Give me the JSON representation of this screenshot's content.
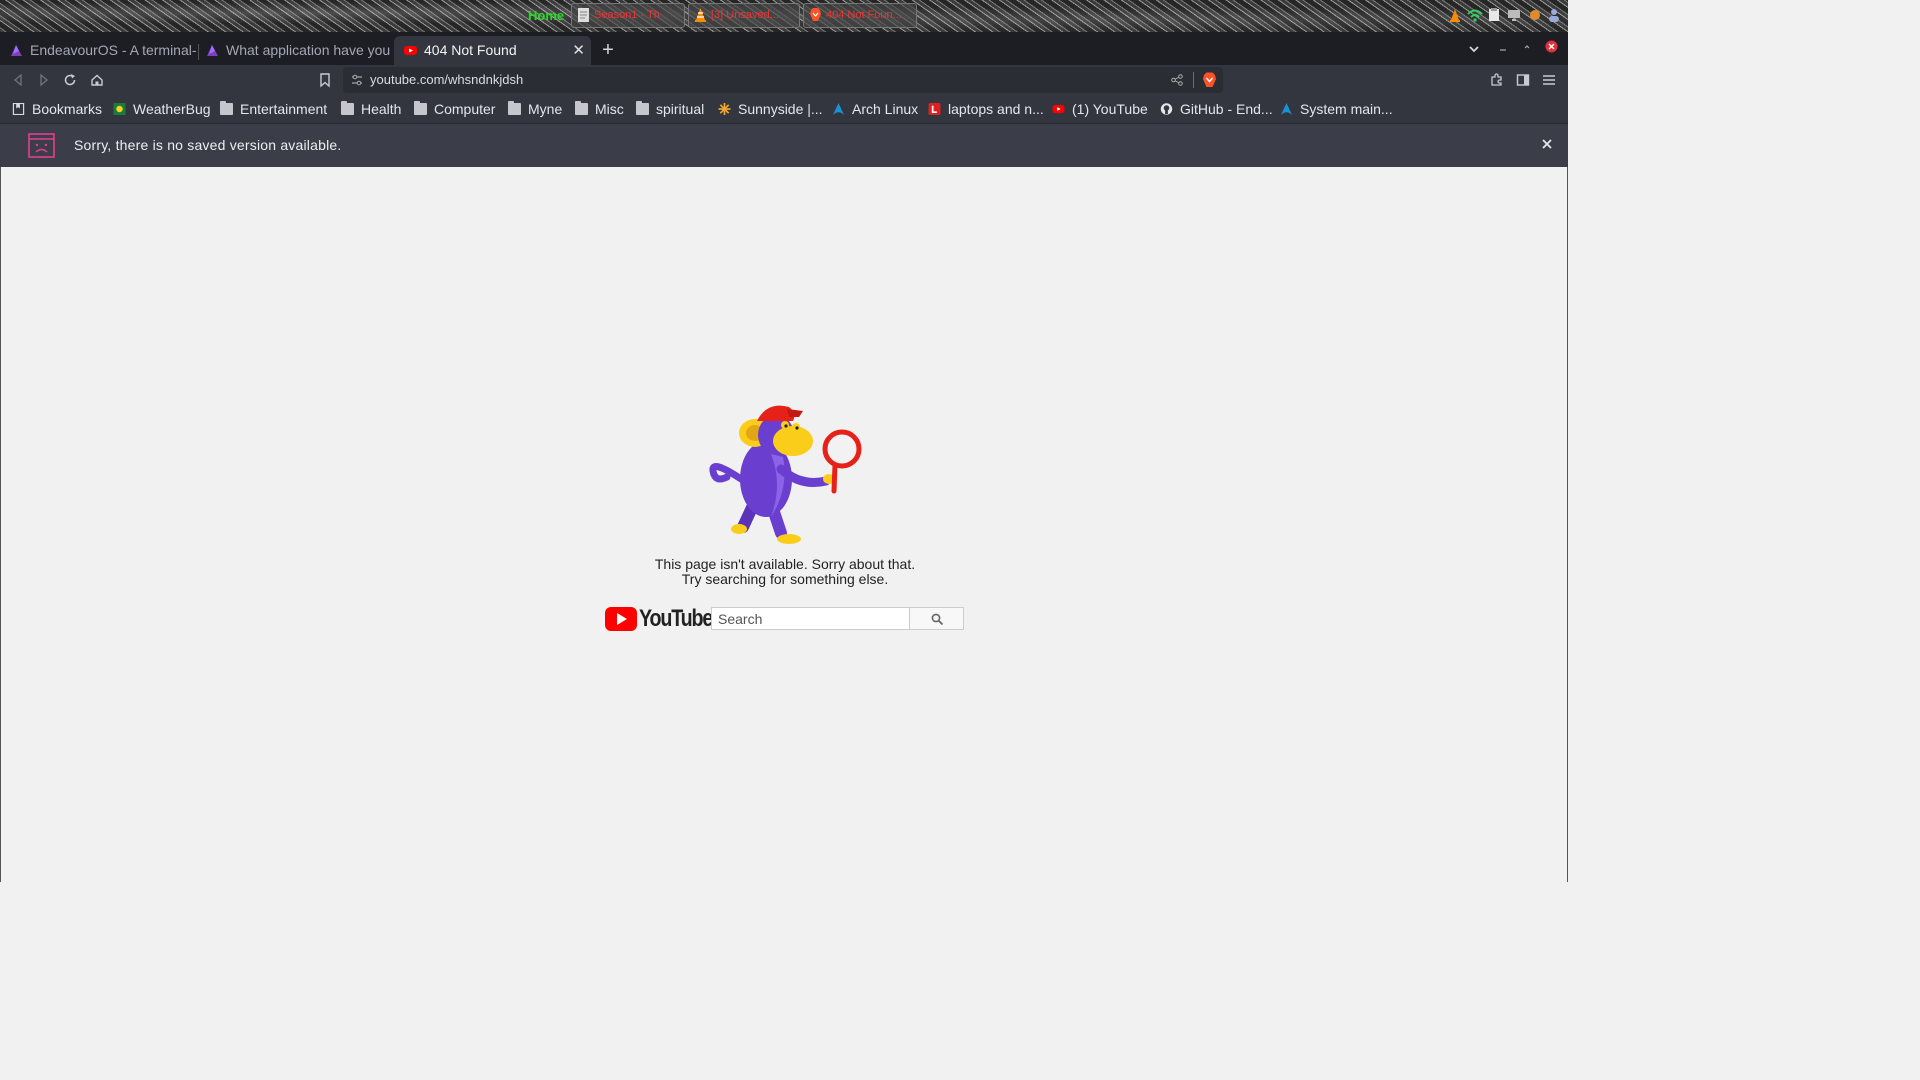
{
  "panel": {
    "home_label": "Home",
    "tasks": [
      {
        "label": "Season1 - Th",
        "icon": "document-icon"
      },
      {
        "label": "[3] Unsaved...",
        "icon": "vlc-cone-icon"
      },
      {
        "label": "404 Not Foun...",
        "icon": "brave-lion-icon"
      }
    ]
  },
  "tabs": [
    {
      "title": "EndeavourOS - A terminal-",
      "icon": "endeavouros-icon"
    },
    {
      "title": "What application have you",
      "icon": "endeavouros-icon"
    },
    {
      "title": "404 Not Found",
      "icon": "youtube-icon",
      "active": true
    }
  ],
  "toolbar": {
    "url": "youtube.com/whsndnkjdsh"
  },
  "bookmarks": [
    {
      "label": "Bookmarks",
      "icon": "bookmarks-icon"
    },
    {
      "label": "WeatherBug",
      "icon": "weatherbug-icon"
    },
    {
      "label": "Entertainment",
      "icon": "folder-icon"
    },
    {
      "label": "Health",
      "icon": "folder-icon"
    },
    {
      "label": "Computer",
      "icon": "folder-icon"
    },
    {
      "label": "Myne",
      "icon": "folder-icon"
    },
    {
      "label": "Misc",
      "icon": "folder-icon"
    },
    {
      "label": "spiritual",
      "icon": "folder-icon"
    },
    {
      "label": "Sunnyside |...",
      "icon": "sun-icon"
    },
    {
      "label": "Arch Linux",
      "icon": "arch-linux-icon"
    },
    {
      "label": "laptops and n...",
      "icon": "letter-l-icon"
    },
    {
      "label": "(1) YouTube",
      "icon": "youtube-icon"
    },
    {
      "label": "GitHub - End...",
      "icon": "github-icon"
    },
    {
      "label": "System main...",
      "icon": "arch-linux-icon"
    }
  ],
  "infobar": {
    "message": "Sorry, there is no saved version available."
  },
  "page": {
    "error_line1": "This page isn't available. Sorry about that.",
    "error_line2": "Try searching for something else.",
    "logo_text": "YouTube",
    "search_placeholder": "Search"
  },
  "colors": {
    "tabstrip_bg": "#1c1e24",
    "toolbar_bg": "#33363f",
    "infobar_bg": "#3b3e48",
    "page_bg": "#f1f1f1",
    "youtube_red": "#ff0000",
    "monkey_purple": "#6a3fd0",
    "monkey_yellow": "#fbcd1b"
  }
}
